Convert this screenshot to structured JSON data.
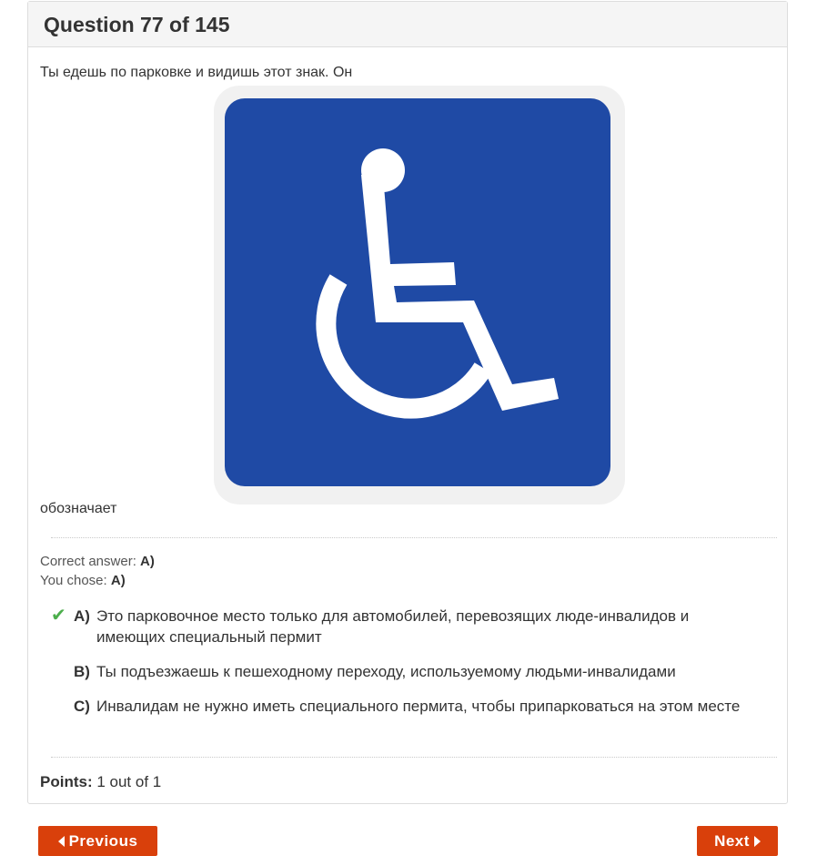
{
  "header": {
    "title": "Question 77 of 145"
  },
  "question": {
    "text_before": "Ты едешь по парковке и видишь этот знак. Он",
    "text_after": "обозначает",
    "image_icon": "wheelchair-accessible-sign-icon",
    "sign_color": "#1f4aa5"
  },
  "result": {
    "correct_label": "Correct answer:",
    "correct_value": "A)",
    "chose_label": "You chose:",
    "chose_value": "A)"
  },
  "options": [
    {
      "letter": "A)",
      "text": "Это парковочное место только для автомобилей, перевозящих люде-инвалидов и имеющих специальный пермит",
      "correct": true
    },
    {
      "letter": "B)",
      "text": "Ты подъезжаешь к пешеходному переходу, используемому людьми-инвалидами"
    },
    {
      "letter": "C)",
      "text": "Инвалидам не нужно иметь специального пермита, чтобы припарковаться на этом месте"
    }
  ],
  "points": {
    "label": "Points:",
    "value": "1 out of 1"
  },
  "nav": {
    "previous_label": "Previous",
    "next_label": "Next"
  },
  "colors": {
    "accent": "#d9400b",
    "correct": "#4cae4c"
  }
}
